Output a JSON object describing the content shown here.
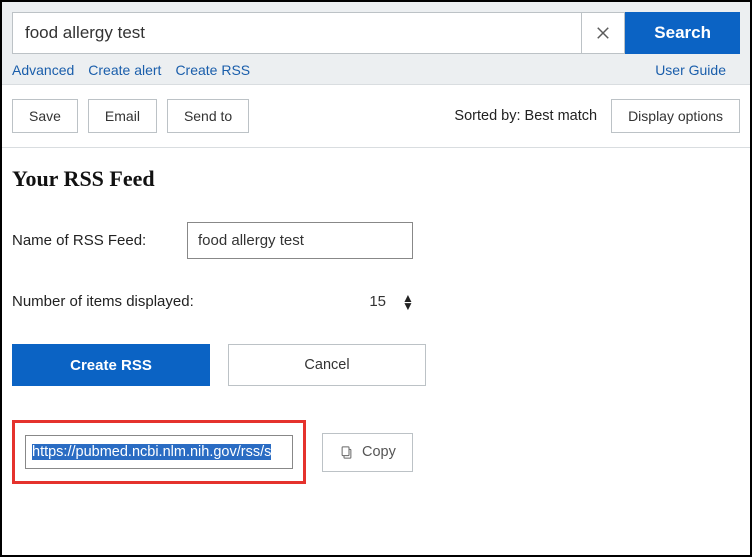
{
  "search": {
    "value": "food allergy test",
    "button": "Search",
    "links": {
      "advanced": "Advanced",
      "create_alert": "Create alert",
      "create_rss": "Create RSS",
      "user_guide": "User Guide"
    }
  },
  "toolbar": {
    "save": "Save",
    "email": "Email",
    "send_to": "Send to",
    "sorted_by": "Sorted by: Best match",
    "display_options": "Display options"
  },
  "rss": {
    "heading": "Your RSS Feed",
    "name_label": "Name of RSS Feed:",
    "name_value": "food allergy test",
    "count_label": "Number of items displayed:",
    "count_value": "15",
    "create": "Create RSS",
    "cancel": "Cancel",
    "url": "https://pubmed.ncbi.nlm.nih.gov/rss/s",
    "copy": "Copy"
  }
}
